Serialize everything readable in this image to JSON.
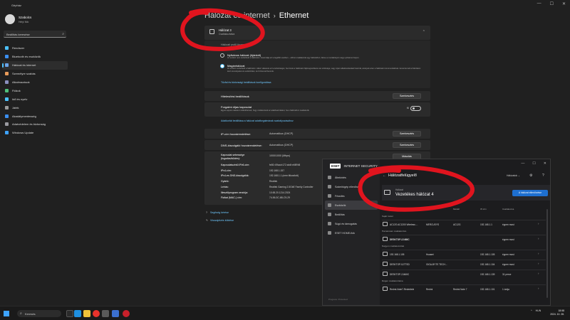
{
  "settings": {
    "title": "Gépház",
    "user": {
      "name": "Szabolcs",
      "email": "Helyi fiók"
    },
    "search_placeholder": "Beállítás keresése",
    "nav": [
      {
        "label": "Rendszer",
        "color": "#4cc2ff"
      },
      {
        "label": "Bluetooth és eszközök",
        "color": "#3b8ff0"
      },
      {
        "label": "Hálózat és internet",
        "color": "#6aa4e8",
        "active": true
      },
      {
        "label": "Személyre szabás",
        "color": "#e89b5a"
      },
      {
        "label": "Alkalmazások",
        "color": "#8a8fbf"
      },
      {
        "label": "Fiókok",
        "color": "#4fbf7a"
      },
      {
        "label": "Idő és nyelv",
        "color": "#4cc2ff"
      },
      {
        "label": "Játék",
        "color": "#9a9a9a"
      },
      {
        "label": "Akadálymentesség",
        "color": "#3b8ff0"
      },
      {
        "label": "Adatvédelem és biztonság",
        "color": "#9a9aa0"
      },
      {
        "label": "Windows Update",
        "color": "#3ea3ff"
      }
    ],
    "breadcrumb": {
      "parent": "Hálózat és internet",
      "current": "Ethernet"
    },
    "network_card": {
      "name": "Hálózat 3",
      "status": "Csatlakoztatva"
    },
    "profile": {
      "label": "Hálózati profil típusa",
      "public": {
        "title": "Nyilvános hálózat (Ajánlott)",
        "desc": "Az eszköz nem észlelhető a hálózaton. Használja ezt a legtöbb esetben – otthoni csatlakozás egy hálózathoz, illetve a munkahelyén vagy nyilvános helyen."
      },
      "private": {
        "title": "Magánhálózat",
        "desc": "Az eszköz észlelhető a hálózaton. Akkor válassza ezt a lehetőséget, ha önnek a hálózaton fájlmegosztásra van szüksége, vagy olyan alkalmazásokat használ, amelyek ezen a hálózaton kommunikálnak. Ismernie kell a hálózaton lévő személyeket és eszközöket, és bíznia kell bennük."
      },
      "firewall_link": "Tűzfal és biztonsági beállítások konfigurálása"
    },
    "auth": {
      "label": "Hitelesítési beállítások",
      "button": "Szerkesztés"
    },
    "metered": {
      "label": "Forgalmi díjas kapcsolat",
      "desc": "Egyes appok másként működhetnek, hogy csökkentsék az adathasználatot, ha a hálózathoz csatlakozik",
      "state": "Ki"
    },
    "data_limit_link": "Adatkorlát beállítása a hálózat adatforgalmának szabályozásához",
    "ip_assign": {
      "label": "IP-cím hozzárendelése:",
      "value": "Automatikus (DHCP)",
      "button": "Szerkesztés"
    },
    "dns_assign": {
      "label": "DNS-kiszolgáló hozzárendelése:",
      "value": "Automatikus (DHCP)",
      "button": "Szerkesztés"
    },
    "link_speed": {
      "label": "Kapcsolat sebessége (fogadás/küldés):",
      "value": "1000/1000 (Mbps)",
      "button": "Másolás"
    },
    "properties": [
      {
        "key": "Kapcsolatszintű IPv6-cím:",
        "value": "fe80::69aa:b172:ab4f:e6f8%8"
      },
      {
        "key": "IPv4-cím:",
        "value": "192.168.1.157"
      },
      {
        "key": "IPv4-es DNS-kiszolgálók:",
        "value": "192.168.1.1 (nem titkosított)"
      },
      {
        "key": "Gyártó:",
        "value": "Realtek"
      },
      {
        "key": "Leírás:",
        "value": "Realtek Gaming 2.5GbE Family Controller"
      },
      {
        "key": "Illesztőprogram verziója:",
        "value": "10.65.20.1214.2024"
      },
      {
        "key": "Fizikai (MAC-) cím:",
        "value": "74-56-3C-6B-C9-29"
      }
    ],
    "help": [
      "Segítség kérése",
      "Visszajelzés küldése"
    ]
  },
  "eset": {
    "brand": "ESET",
    "product": "INTERNET SECURITY",
    "nav": [
      {
        "label": "Áttekintés"
      },
      {
        "label": "Számítógép ellenőrzése"
      },
      {
        "label": "Frissítés"
      },
      {
        "label": "Eszközök",
        "active": true
      },
      {
        "label": "Beállítás"
      },
      {
        "label": "Súgó és támogatás"
      },
      {
        "label": "ESET HOME-fiók"
      }
    ],
    "footer": "Progress. Protected.",
    "header": {
      "title": "Hálózatfelügyelő",
      "filter": "Hálózatok",
      "gear": "⚙",
      "help": "?"
    },
    "network": {
      "label": "Hálózat",
      "name": "Vezetékes hálózat 4",
      "button": "A hálózat ellenőrzése"
    },
    "columns": [
      "Név",
      "Gyártó",
      "Modell",
      "IP-cím",
      "Csatlakozva"
    ],
    "groups": [
      "Saját router",
      "Hamarosan csatlakozóra",
      "Nagyon csatlakozottak",
      "Régen csatlakoztatva"
    ],
    "devices": [
      {
        "name": "AC12G AC1200 Wireless ...",
        "vendor": "MERCUSYS",
        "model": "AC12G",
        "ip": "192.168.1.1",
        "seen": "éppen most",
        "group": 0
      },
      {
        "name": "DESKTOP-2J46IIC",
        "vendor": "",
        "model": "",
        "ip": "",
        "seen": "éppen most",
        "group": 1,
        "bold": true
      },
      {
        "name": "192.168.1.105",
        "vendor": "Huawei",
        "model": "",
        "ip": "192.168.1.105",
        "seen": "éppen most",
        "group": 2
      },
      {
        "name": "DESKTOP-5J7TSD",
        "vendor": "GIGA-BYTE TECH...",
        "model": "",
        "ip": "192.168.1.104",
        "seen": "éppen most",
        "group": 2
      },
      {
        "name": "DESKTOP-2J46IIC",
        "vendor": "",
        "model": "",
        "ip": "192.168.1.139",
        "seen": "31 perce",
        "group": 2
      },
      {
        "name": "Redmi-Note7-Redmitele",
        "vendor": "Redmi",
        "model": "Redmi Note 7",
        "ip": "192.168.1.101",
        "seen": "1 órája",
        "group": 3
      }
    ]
  },
  "taskbar": {
    "search": "Keresés",
    "tray": [
      "^",
      "HUN"
    ],
    "time": "18:58",
    "date": "2024. 10. 28."
  }
}
